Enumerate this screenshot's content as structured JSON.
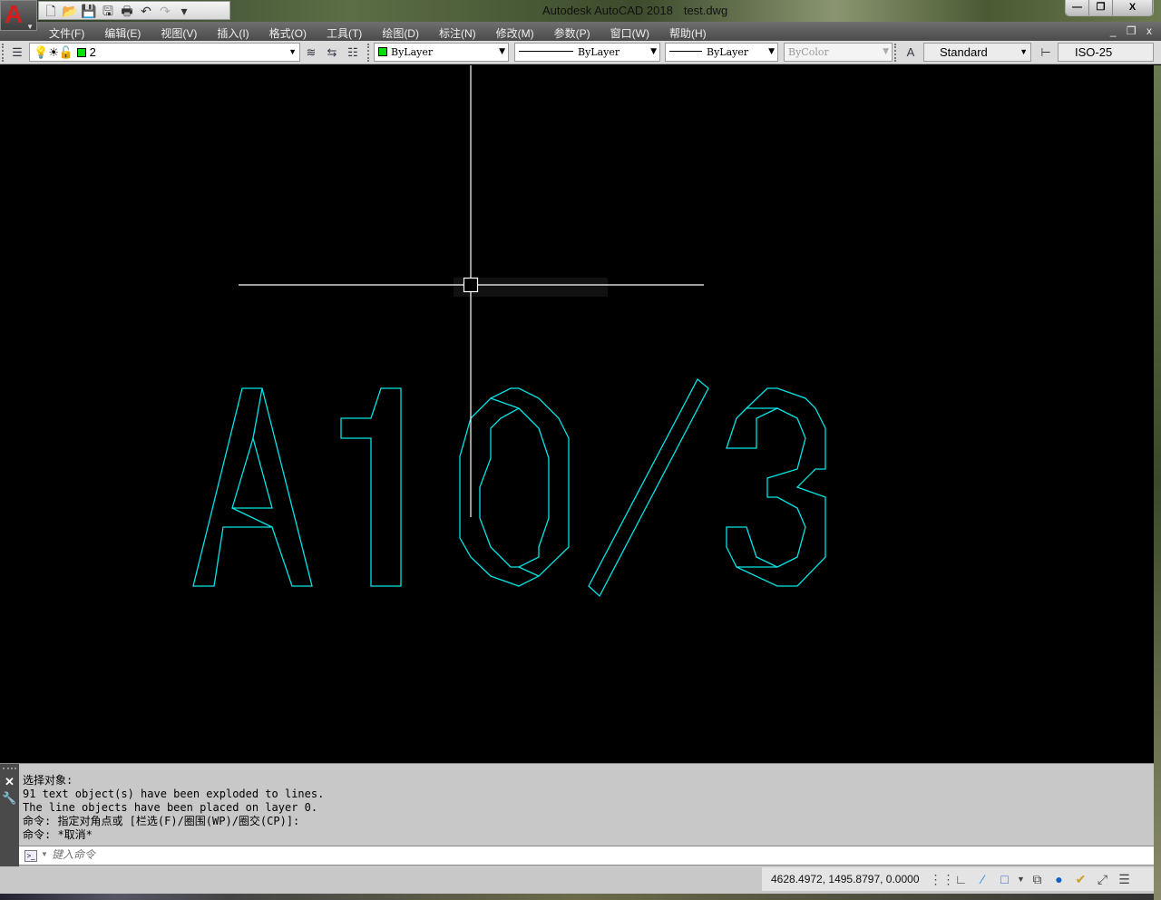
{
  "window": {
    "app_title": "Autodesk AutoCAD 2018",
    "file": "test.dwg",
    "app_logo": "A",
    "buttons": {
      "minimize": "—",
      "restore": "❐",
      "close": "X"
    }
  },
  "quick_access": [
    "new-icon",
    "open-icon",
    "save-icon",
    "save-as-icon",
    "plot-icon",
    "undo-icon",
    "redo-icon",
    "customize-icon"
  ],
  "menu": [
    "文件(F)",
    "编辑(E)",
    "视图(V)",
    "插入(I)",
    "格式(O)",
    "工具(T)",
    "绘图(D)",
    "标注(N)",
    "修改(M)",
    "参数(P)",
    "窗口(W)",
    "帮助(H)"
  ],
  "toolbar": {
    "layer": "2",
    "color": "ByLayer",
    "linetype": "ByLayer",
    "lineweight": "ByLayer",
    "plotstyle": "ByColor",
    "textstyle": "Standard",
    "dimstyle": "ISO-25",
    "layer_color": "#00e000"
  },
  "drawing": {
    "entity_color": "#00e5e5",
    "text": "A10/3"
  },
  "command": {
    "history": [
      "选择对象:",
      "91 text object(s) have been exploded to lines.",
      "The line objects have been placed on layer 0.",
      "命令: 指定对角点或 [栏选(F)/圈围(WP)/圈交(CP)]:",
      "命令: *取消*"
    ],
    "placeholder": "键入命令"
  },
  "status": {
    "coordinates": "4628.4972, 1495.8797, 0.0000"
  }
}
